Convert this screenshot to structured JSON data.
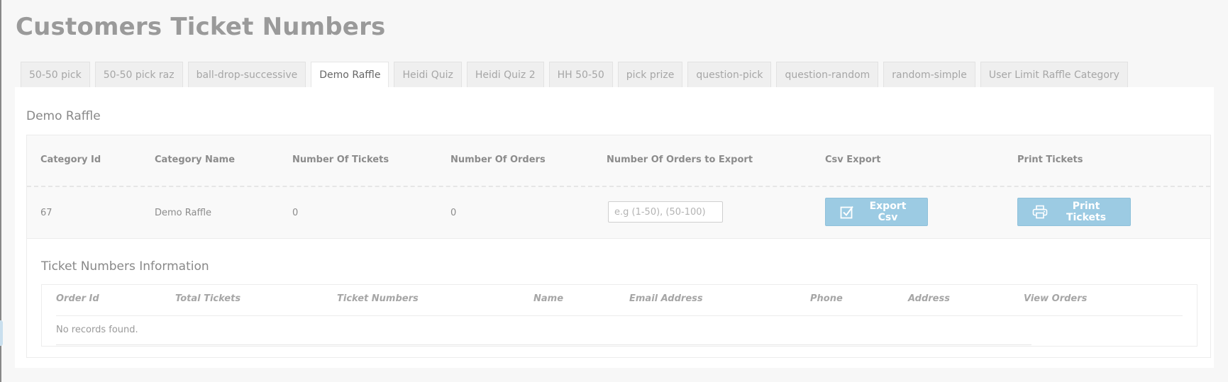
{
  "page": {
    "title": "Customers Ticket Numbers"
  },
  "tabs": [
    {
      "label": "50-50 pick"
    },
    {
      "label": "50-50 pick raz"
    },
    {
      "label": "ball-drop-successive"
    },
    {
      "label": "Demo Raffle",
      "active": true
    },
    {
      "label": "Heidi Quiz"
    },
    {
      "label": "Heidi Quiz 2"
    },
    {
      "label": "HH 50-50"
    },
    {
      "label": "pick prize"
    },
    {
      "label": "question-pick"
    },
    {
      "label": "question-random"
    },
    {
      "label": "random-simple"
    },
    {
      "label": "User Limit Raffle Category"
    }
  ],
  "panel": {
    "title": "Demo Raffle"
  },
  "category_table": {
    "headers": {
      "category_id": "Category Id",
      "category_name": "Category Name",
      "number_of_tickets": "Number Of Tickets",
      "number_of_orders": "Number Of Orders",
      "orders_to_export": "Number Of Orders to Export",
      "csv_export": "Csv Export",
      "print_tickets": "Print Tickets"
    },
    "row": {
      "category_id": "67",
      "category_name": "Demo Raffle",
      "number_of_tickets": "0",
      "number_of_orders": "0",
      "orders_input_placeholder": "e.g (1-50), (50-100)",
      "orders_input_value": "",
      "export_button_label": "Export Csv",
      "print_button_label": "Print Tickets"
    }
  },
  "ticket_info": {
    "title": "Ticket Numbers Information",
    "headers": {
      "order_id": "Order Id",
      "total_tickets": "Total Tickets",
      "ticket_numbers": "Ticket Numbers",
      "name": "Name",
      "email": "Email Address",
      "phone": "Phone",
      "address": "Address",
      "view_orders": "View Orders"
    },
    "empty_message": "No records found."
  },
  "icons": {
    "export": "check-square-icon",
    "print": "printer-icon"
  },
  "colors": {
    "button_bg": "#9ccbe3",
    "title": "#9a9a9a",
    "page_bg": "#f7f7f7"
  }
}
